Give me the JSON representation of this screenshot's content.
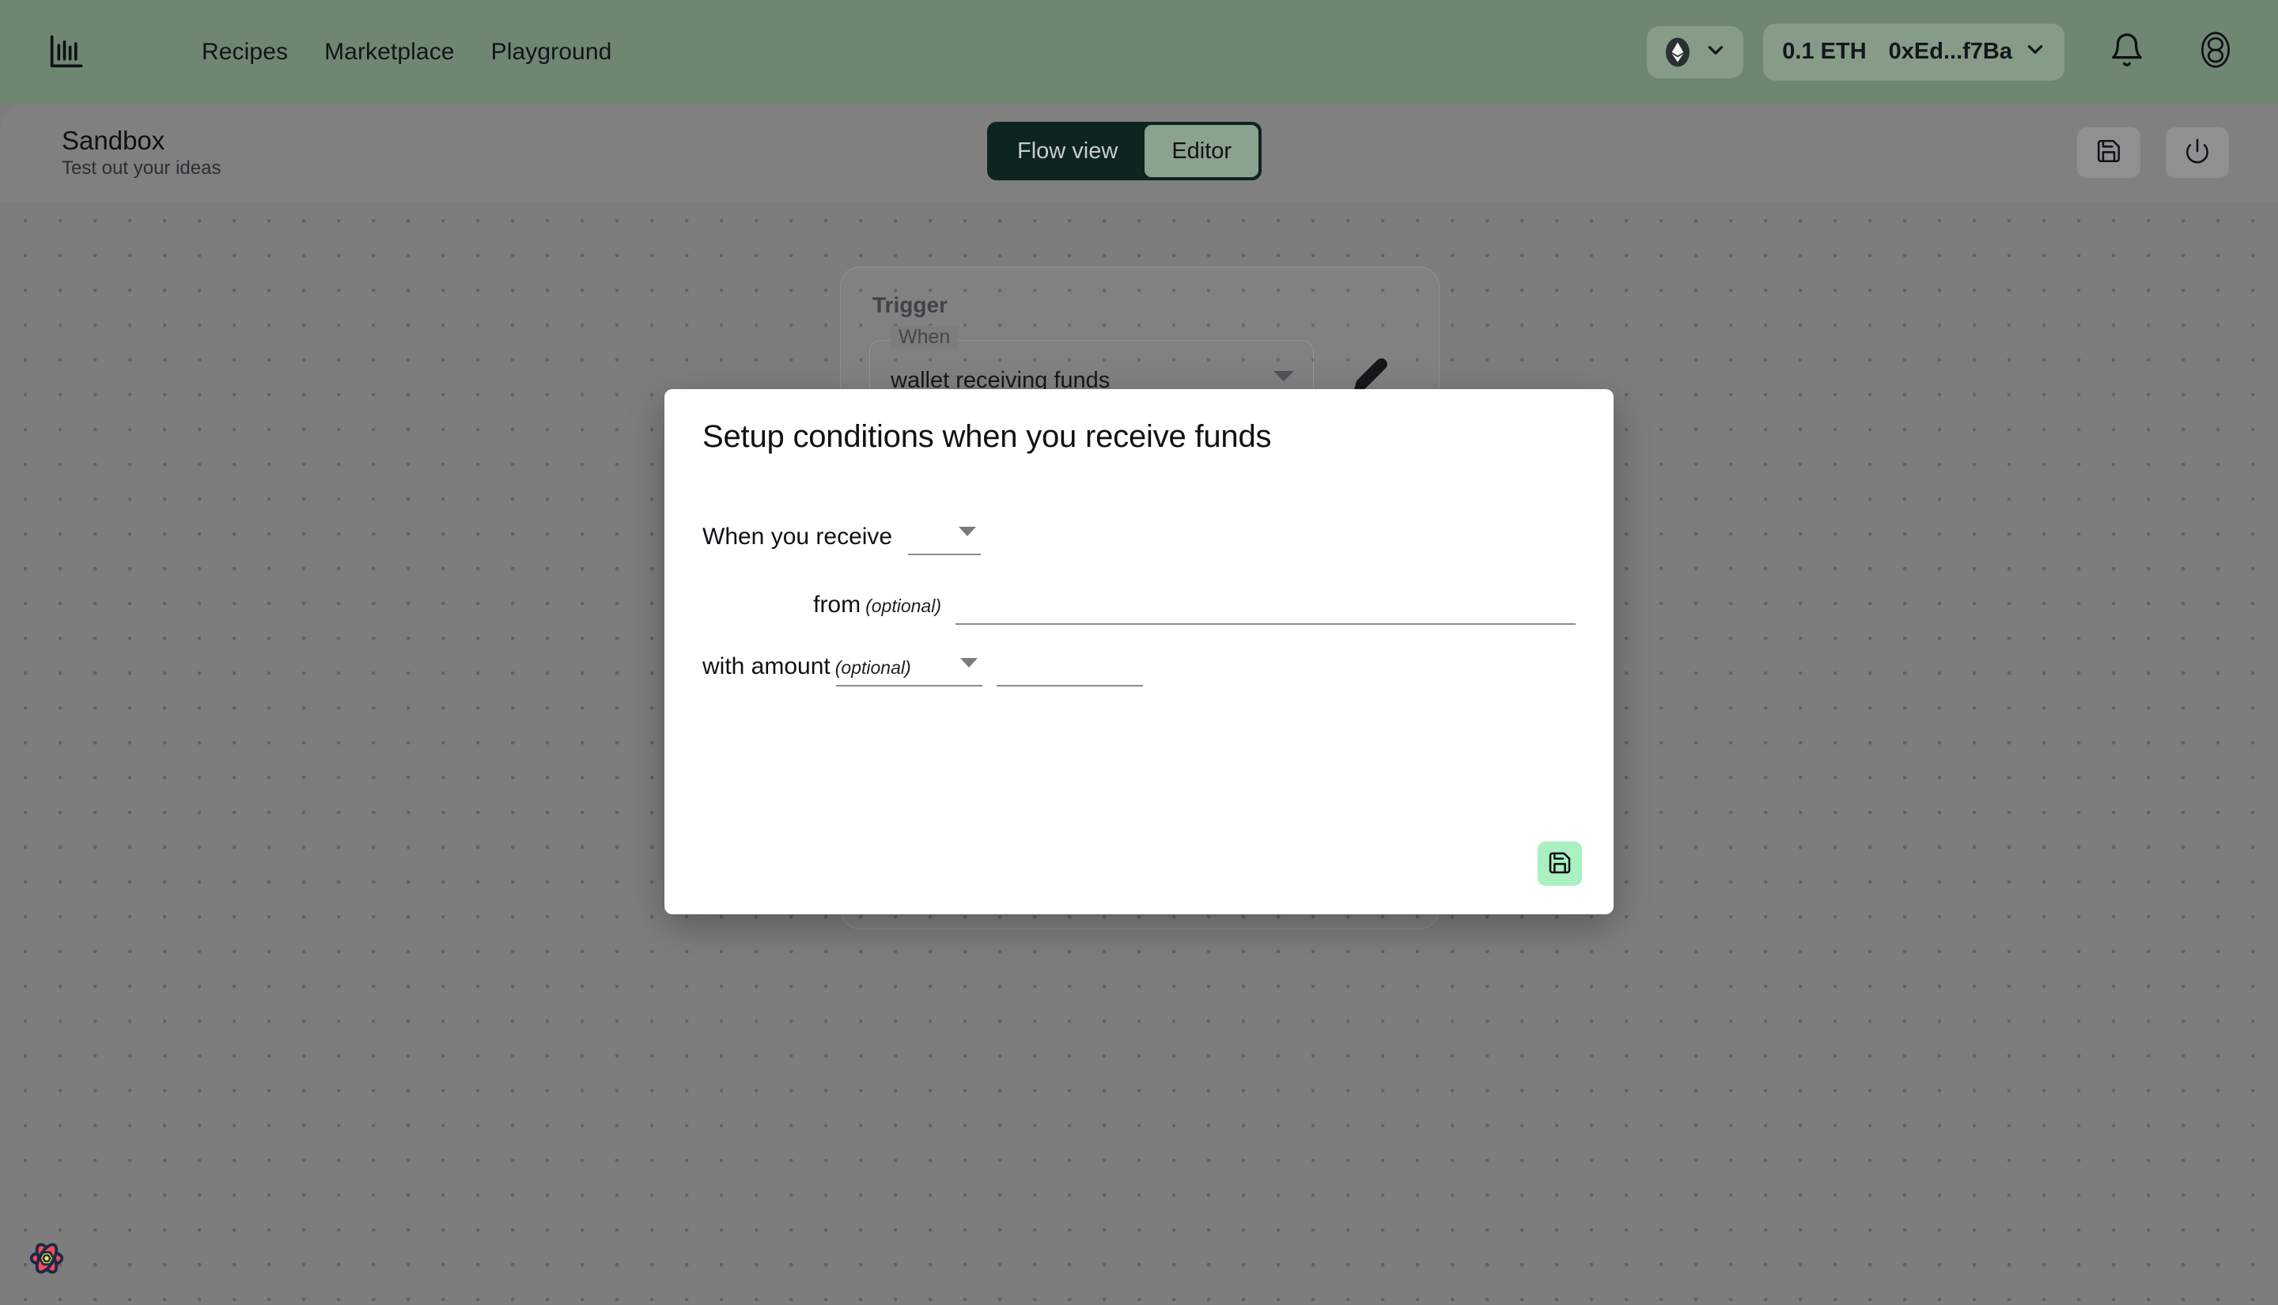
{
  "nav": {
    "logo_icon": "bar-chart-logo",
    "links": [
      {
        "label": "Recipes"
      },
      {
        "label": "Marketplace"
      },
      {
        "label": "Playground"
      }
    ],
    "chain_selector": {
      "icon": "ethereum-icon",
      "caret_icon": "chevron-down-icon"
    },
    "wallet": {
      "balance": "0.1 ETH",
      "address": "0xEd...f7Ba",
      "caret_icon": "chevron-down-icon"
    },
    "notifications_icon": "bell-icon",
    "profile_icon": "profile-icon"
  },
  "header": {
    "title": "Sandbox",
    "subtitle": "Test out your ideas",
    "view_toggle": {
      "options": [
        {
          "label": "Flow view",
          "active": false
        },
        {
          "label": "Editor",
          "active": true
        }
      ]
    },
    "actions": [
      {
        "name": "save-workflow-button",
        "icon": "floppy-disk-icon"
      },
      {
        "name": "power-button",
        "icon": "power-icon"
      }
    ]
  },
  "canvas": {
    "trigger_card": {
      "title": "Trigger",
      "when_legend": "When",
      "when_value": "wallet receiving funds",
      "caret_icon": "triangle-down-icon",
      "edit_icon": "pencil-icon"
    },
    "react_logo_icon": "react-atom-logo"
  },
  "modal": {
    "title": "Setup conditions when you receive funds",
    "fields": {
      "receive": {
        "label": "When you receive",
        "value": "",
        "placeholder": "",
        "caret_icon": "triangle-down-icon"
      },
      "from": {
        "label": "from",
        "optional_tag": "(optional)",
        "value": "",
        "placeholder": ""
      },
      "amount": {
        "label": "with amount",
        "optional_tag": "(optional)",
        "operator_value": "",
        "operator_placeholder": "",
        "operator_caret_icon": "triangle-down-icon",
        "value": "",
        "placeholder": ""
      }
    },
    "save_button": {
      "label": "",
      "icon": "floppy-disk-icon"
    }
  },
  "colors": {
    "nav_green": "#6f8772",
    "toggle_dark": "#0e2420",
    "toggle_active": "#8ba28e",
    "canvas_gray": "#7d7d7d",
    "save_accent": "#aaf0c0"
  }
}
